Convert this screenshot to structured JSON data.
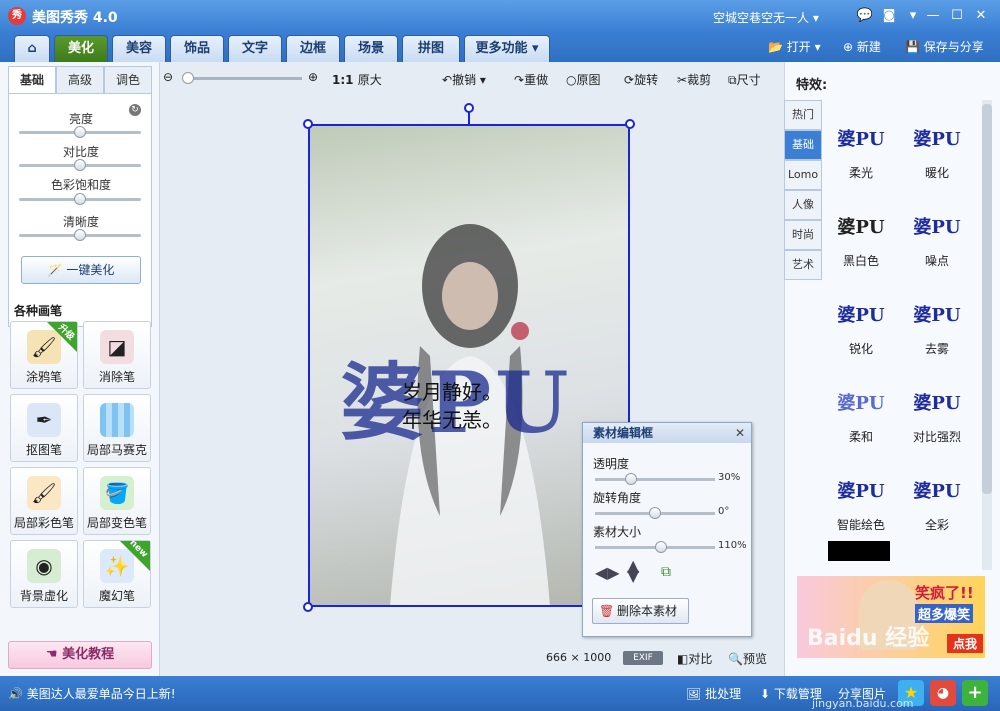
{
  "app": {
    "title": "美图秀秀 4.0",
    "logo_text": "秀",
    "user": "空城空巷空无一人"
  },
  "menu": {
    "tabs": [
      "美化",
      "美容",
      "饰品",
      "文字",
      "边框",
      "场景",
      "拼图",
      "更多功能"
    ],
    "active": "美化",
    "open": "打开",
    "new": "新建",
    "save": "保存与分享"
  },
  "left": {
    "subtabs": [
      "基础",
      "高级",
      "调色"
    ],
    "sliders": [
      {
        "label": "亮度",
        "value": 0.5
      },
      {
        "label": "对比度",
        "value": 0.5
      },
      {
        "label": "色彩饱和度",
        "value": 0.5
      },
      {
        "label": "清晰度",
        "value": 0.5
      }
    ],
    "one_key": "一键美化",
    "brushes_title": "各种画笔",
    "brushes": [
      {
        "label": "涂鸦笔",
        "badge": "升级"
      },
      {
        "label": "消除笔",
        "badge": ""
      },
      {
        "label": "抠图笔",
        "badge": ""
      },
      {
        "label": "局部马赛克",
        "badge": ""
      },
      {
        "label": "局部彩色笔",
        "badge": ""
      },
      {
        "label": "局部变色笔",
        "badge": ""
      },
      {
        "label": "背景虚化",
        "badge": ""
      },
      {
        "label": "魔幻笔",
        "badge": "new"
      }
    ],
    "tutorial": "美化教程"
  },
  "toolbar": {
    "zoom_ratio": "1:1",
    "original_size": "原大",
    "undo": "撤销",
    "redo": "重做",
    "original": "原图",
    "rotate": "旋转",
    "crop": "裁剪",
    "size": "尺寸"
  },
  "canvas": {
    "overlay_big": "婆PU",
    "poem_line1": "岁月静好。",
    "poem_line2": "年华无恙。"
  },
  "material_editor": {
    "title": "素材编辑框",
    "opacity_label": "透明度",
    "opacity_value": "30%",
    "opacity": 0.3,
    "rotation_label": "旋转角度",
    "rotation_value": "0°",
    "rotation": 0.5,
    "size_label": "素材大小",
    "size_value": "110%",
    "size": 0.55,
    "delete": "删除本素材"
  },
  "status": {
    "width": "666",
    "times": "×",
    "height": "1000",
    "exif": "EXIF",
    "compare": "对比",
    "preview": "预览"
  },
  "effects": {
    "title": "特效:",
    "categories": [
      "热门",
      "基础",
      "Lomo",
      "人像",
      "时尚",
      "艺术"
    ],
    "active_category": "基础",
    "items": [
      "柔光",
      "暖化",
      "黑白色",
      "噪点",
      "锐化",
      "去雾",
      "柔和",
      "对比强烈",
      "智能绘色",
      "全彩"
    ],
    "thumb_text": "婆PU"
  },
  "ad": {
    "line1": "笑疯了!!",
    "line2": "超多爆笑",
    "cta": "点我",
    "watermark": "Baidu 经验"
  },
  "bottom": {
    "news": "美图达人最爱单品今日上新!",
    "batch": "批处理",
    "download": "下载管理",
    "share": "分享图片",
    "site": "jingyan.baidu.com"
  }
}
